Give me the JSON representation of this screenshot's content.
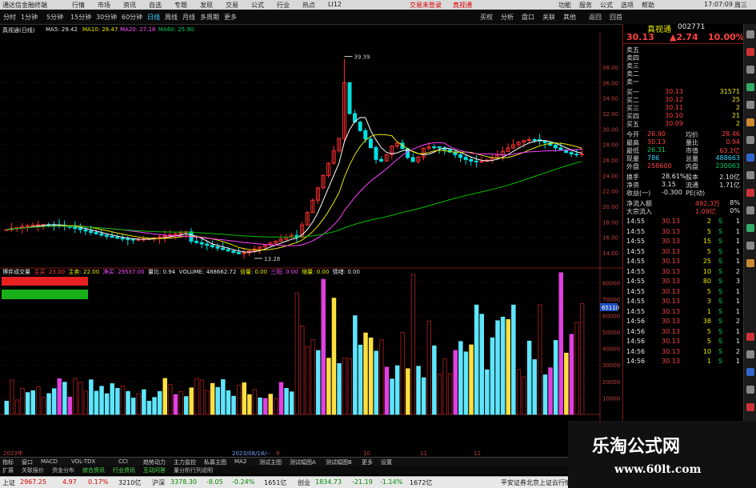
{
  "window": {
    "app_title": "通达信金融终端",
    "menu": [
      "行情",
      "市场",
      "资讯",
      "自选",
      "专题",
      "发现",
      "交易",
      "公式",
      "行业",
      "热点",
      "LI12"
    ],
    "center_links": [
      "交易未登录",
      "真视通"
    ],
    "right_menu": [
      "功能",
      "服务",
      "公式",
      "选项",
      "帮助"
    ],
    "time": "17:07:09",
    "weekday": "周三"
  },
  "toolbar": {
    "periods": [
      "分时",
      "1分钟",
      "5分钟",
      "15分钟",
      "30分钟",
      "60分钟",
      "日线",
      "周线",
      "月线",
      "多周期",
      "更多"
    ],
    "active_period": "日线",
    "quick_nav": [
      "退出",
      "扩展",
      "返回",
      "前页",
      "后页",
      "回首"
    ],
    "right_tabs": [
      "买权",
      "分析",
      "盘口",
      "关联",
      "其他"
    ]
  },
  "chart_info": {
    "stock_label": "真视通(日线)",
    "ma5": "MA5: 29.42",
    "ma10": "MA10: 28.47",
    "ma20": "MA20: 27.18",
    "ma60": "MA60: 25.90",
    "high_label": "39.39",
    "low_label": "13.28"
  },
  "price_axis": [
    "38.00",
    "36.00",
    "34.00",
    "32.00",
    "30.00",
    "28.00",
    "26.00",
    "24.00",
    "22.00",
    "20.00",
    "18.00",
    "16.00",
    "14.00"
  ],
  "volume_axis": [
    "80000",
    "70000",
    "60000",
    "50000",
    "40000",
    "30000",
    "20000",
    "10000"
  ],
  "volume_marker": "65110",
  "indicator_header": {
    "name": "博弈成交量",
    "main_buy": "主买: 23.00",
    "main_sell": "主卖: 22.00",
    "net": "净买: 29537.00",
    "ratio": "量比: 0.94",
    "volume": "VOLUME: 488662.72",
    "double": "倍量: 0.00",
    "three_yang": "三阳: 0.00",
    "vol_shrink": "缩量: 0.00",
    "emotion": "情绪: 0.00"
  },
  "date_axis": [
    "2023年",
    "2023/08/18/--",
    "9",
    "10",
    "11",
    "12"
  ],
  "quote": {
    "name": "真视通",
    "code": "002771",
    "price": "30.13",
    "change": "▲2.74",
    "pct": "10.00%",
    "sell": [
      {
        "label": "卖五",
        "price": "",
        "vol": ""
      },
      {
        "label": "卖四",
        "price": "",
        "vol": ""
      },
      {
        "label": "卖三",
        "price": "",
        "vol": ""
      },
      {
        "label": "卖二",
        "price": "",
        "vol": ""
      },
      {
        "label": "卖一",
        "price": "",
        "vol": ""
      }
    ],
    "buy": [
      {
        "label": "买一",
        "price": "30.13",
        "vol": "31571"
      },
      {
        "label": "买二",
        "price": "30.12",
        "vol": "25"
      },
      {
        "label": "买三",
        "price": "30.11",
        "vol": "2"
      },
      {
        "label": "买四",
        "price": "30.10",
        "vol": "21"
      },
      {
        "label": "买五",
        "price": "30.09",
        "vol": "2"
      }
    ],
    "stats": [
      {
        "l1": "今开",
        "v1": "26.90",
        "l2": "均价",
        "v2": "28.46"
      },
      {
        "l1": "最高",
        "v1": "30.13",
        "l2": "量比",
        "v2": "0.94"
      },
      {
        "l1": "最低",
        "v1": "26.31",
        "l2": "市值",
        "v2": "63.2亿"
      },
      {
        "l1": "现量",
        "v1": "786",
        "l2": "总量",
        "v2": "488663"
      },
      {
        "l1": "外盘",
        "v1": "258600",
        "l2": "内盘",
        "v2": "230063"
      }
    ],
    "stats2": [
      {
        "l1": "换手",
        "v1": "28.61%",
        "l2": "股本",
        "v2": "2.10亿"
      },
      {
        "l1": "净资",
        "v1": "3.15",
        "l2": "流通",
        "v2": "1.71亿"
      },
      {
        "l1": "收益(一)",
        "v1": "-0.300",
        "l2": "PE(动)",
        "v2": ""
      }
    ],
    "flows": [
      {
        "label": "净流入额",
        "value": "492.3万",
        "pct": "8%"
      },
      {
        "label": "大宗流入",
        "value": "1.09亿",
        "pct": "0%"
      }
    ],
    "ticks": [
      {
        "t": "14:55",
        "p": "30.13",
        "v": "2",
        "s": "S",
        "n": "1"
      },
      {
        "t": "14:55",
        "p": "30.13",
        "v": "5",
        "s": "S",
        "n": "1"
      },
      {
        "t": "14:55",
        "p": "30.13",
        "v": "15",
        "s": "S",
        "n": "1"
      },
      {
        "t": "14:55",
        "p": "30.13",
        "v": "5",
        "s": "S",
        "n": "1"
      },
      {
        "t": "14:55",
        "p": "30.13",
        "v": "25",
        "s": "S",
        "n": "1"
      },
      {
        "t": "14:55",
        "p": "30.13",
        "v": "10",
        "s": "S",
        "n": "2"
      },
      {
        "t": "14:55",
        "p": "30.13",
        "v": "80",
        "s": "S",
        "n": "3"
      },
      {
        "t": "14:55",
        "p": "30.13",
        "v": "5",
        "s": "S",
        "n": "1"
      },
      {
        "t": "14:55",
        "p": "30.13",
        "v": "3",
        "s": "S",
        "n": "1"
      },
      {
        "t": "14:55",
        "p": "30.13",
        "v": "1",
        "s": "S",
        "n": "1"
      },
      {
        "t": "14:56",
        "p": "30.13",
        "v": "38",
        "s": "S",
        "n": "2"
      },
      {
        "t": "14:56",
        "p": "30.13",
        "v": "5",
        "s": "S",
        "n": "1"
      },
      {
        "t": "14:56",
        "p": "30.13",
        "v": "5",
        "s": "S",
        "n": "1"
      },
      {
        "t": "14:56",
        "p": "30.13",
        "v": "10",
        "s": "S",
        "n": "2"
      },
      {
        "t": "14:56",
        "p": "30.13",
        "v": "1",
        "s": "S",
        "n": "1"
      }
    ]
  },
  "indicator_tabs": [
    "指标",
    "窗口",
    "MACD",
    "VOL-TDX",
    "CCI",
    "趋势动力",
    "主力监控",
    "私募主图",
    "MA2",
    "测试主图",
    "测试幅图A",
    "测试幅图B",
    "更多",
    "设置"
  ],
  "sub_tabs": [
    "扩展",
    "关联报价",
    "资金分布",
    "综合资讯",
    "行业资讯",
    "互动问答",
    "量分析行列说明"
  ],
  "status": {
    "sh_label": "上证",
    "sh_val": "2967.25",
    "sh_chg": "4.97",
    "sh_pct": "0.17%",
    "sh_amt": "3210亿",
    "sz_label": "沪深",
    "sz_val": "3378.30",
    "sz_chg": "-8.05",
    "sz_pct": "-0.24%",
    "sz_amt": "1651亿",
    "cy_label": "创业",
    "cy_val": "1834.73",
    "cy_chg": "-21.19",
    "cy_pct": "-1.14%",
    "cy_amt": "1672亿",
    "broker": "平安证券北京上证云行情"
  },
  "watermark": {
    "title": "乐淘公式网",
    "url": "www.60lt.com"
  },
  "colors": {
    "up": "#ff3030",
    "down": "#00e0e0",
    "ma5": "#ffffff",
    "ma10": "#e8e800",
    "ma20": "#ff40ff",
    "ma60": "#00c000",
    "vol_cyan": "#5fe6ff",
    "vol_red": "#8b1a1a",
    "vol_yellow": "#ffe040",
    "vol_magenta": "#e040e0"
  }
}
